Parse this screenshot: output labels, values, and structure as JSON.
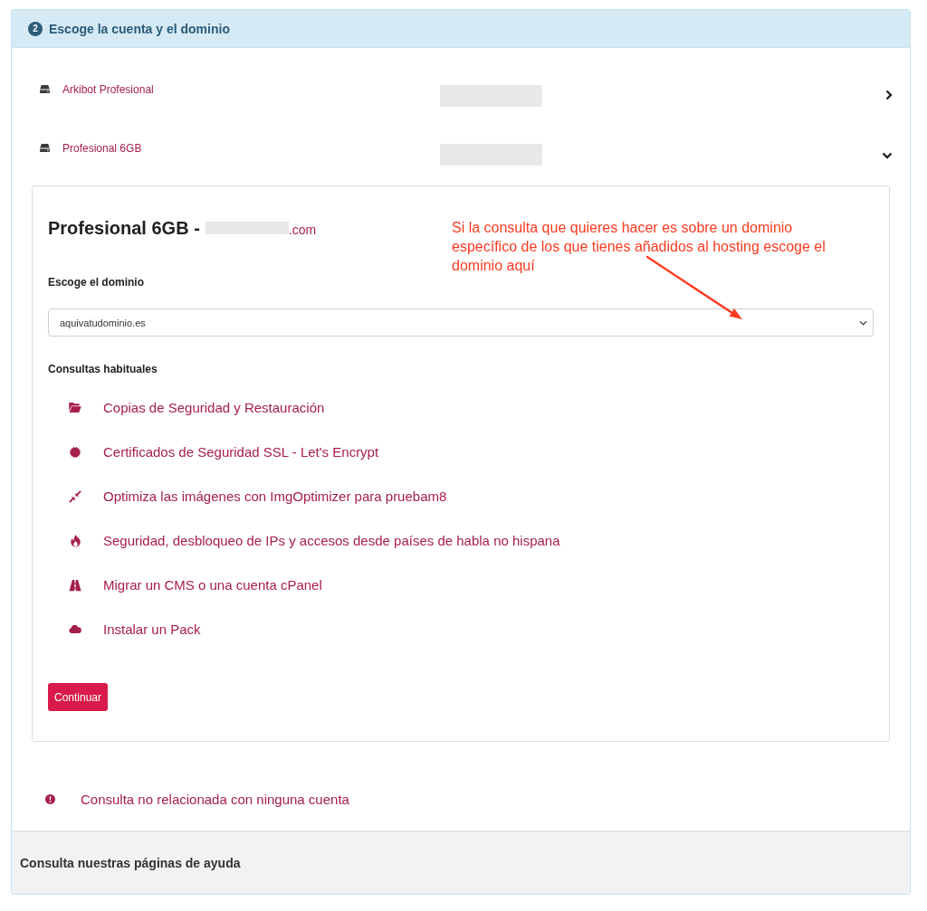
{
  "step": {
    "number": "2",
    "title": "Escoge la cuenta y el dominio"
  },
  "accounts": [
    {
      "name": "Arkibot Profesional",
      "redacted": true,
      "expanded": false
    },
    {
      "name": "Profesional 6GB",
      "redacted": true,
      "expanded": true,
      "detail": {
        "title": "Profesional 6GB -",
        "domain_redacted": true,
        "domain_suffix": ".com",
        "domain_label": "Escoge el dominio",
        "domain_select": {
          "value": "aquivatudominio.es"
        },
        "queries_label": "Consultas habituales",
        "queries": [
          {
            "kind": "folder",
            "label": "Copias de Seguridad y Restauración"
          },
          {
            "kind": "badge",
            "label": "Certificados de Seguridad SSL - Let's Encrypt"
          },
          {
            "kind": "compress",
            "label": "Optimiza las imágenes con ImgOptimizer para pruebam8"
          },
          {
            "kind": "flame",
            "label": "Seguridad, desbloqueo de IPs y accesos desde países de habla no hispana"
          },
          {
            "kind": "road",
            "label": "Migrar un CMS o una cuenta cPanel"
          },
          {
            "kind": "cloud",
            "label": "Instalar un Pack"
          }
        ],
        "continue_button": "Continuar"
      }
    }
  ],
  "annotation": {
    "text": "Si la consulta que quieres hacer es sobre un dominio específico de los que tienes añadidos al hosting escoge el dominio aquí"
  },
  "other_query": {
    "label": "Consulta no relacionada con ninguna cuenta"
  },
  "help_footer": {
    "label": "Consulta nuestras páginas de ayuda"
  }
}
